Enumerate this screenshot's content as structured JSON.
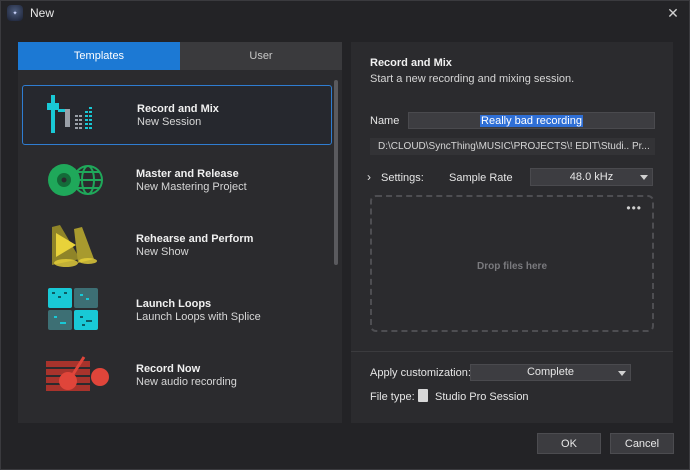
{
  "window": {
    "title": "New"
  },
  "tabs": [
    {
      "label": "Templates",
      "active": true
    },
    {
      "label": "User",
      "active": false
    }
  ],
  "templates": [
    {
      "title": "Record and Mix",
      "subtitle": "New Session",
      "icon": "mixer-fader-icon",
      "selected": true
    },
    {
      "title": "Master and Release",
      "subtitle": "New Mastering Project",
      "icon": "disc-globe-icon",
      "selected": false
    },
    {
      "title": "Rehearse and Perform",
      "subtitle": "New Show",
      "icon": "stage-spotlight-icon",
      "selected": false
    },
    {
      "title": "Launch Loops",
      "subtitle": "Launch Loops with Splice",
      "icon": "loop-pads-icon",
      "selected": false
    },
    {
      "title": "Record Now",
      "subtitle": "New audio recording",
      "icon": "guitar-record-icon",
      "selected": false
    }
  ],
  "details": {
    "title": "Record and Mix",
    "description": "Start a new recording and mixing session.",
    "name_label": "Name",
    "name_value": "Really bad recording",
    "path": "D:\\CLOUD\\SyncThing\\MUSIC\\PROJECTS\\! EDIT\\Studi.. Pr...",
    "settings_label": "Settings:",
    "sample_rate_label": "Sample Rate",
    "sample_rate_value": "48.0 kHz",
    "dropzone_text": "Drop files here",
    "apply_label": "Apply customization:",
    "apply_value": "Complete",
    "file_type_label": "File type:",
    "file_type_value": "Studio Pro Session"
  },
  "buttons": {
    "ok": "OK",
    "cancel": "Cancel"
  },
  "colors": {
    "accent": "#1c79d4",
    "selection_border": "#2f7dd1",
    "cyan": "#19c9d6",
    "green": "#1fa85a",
    "yellow": "#e8d23a",
    "red": "#e0453a"
  }
}
